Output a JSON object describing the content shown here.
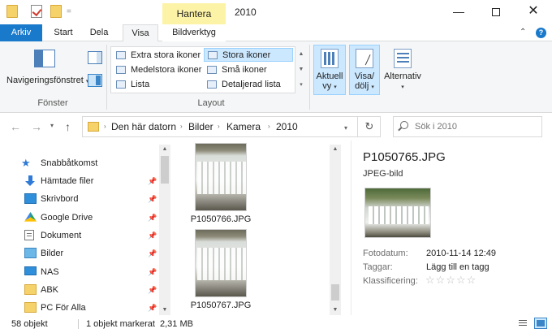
{
  "window": {
    "title": "2010",
    "context_tab": "Hantera",
    "quick_access_sep": "=",
    "minimize": "—",
    "close": "✕"
  },
  "ribbon_tabs": {
    "arkiv": "Arkiv",
    "start": "Start",
    "dela": "Dela",
    "visa": "Visa",
    "bildverktyg": "Bildverktyg",
    "collapse": "⌃",
    "help": "?"
  },
  "ribbon": {
    "navpane_label": "Navigeringsfönstret",
    "navpane_caret": "▾",
    "group_panes": "Fönster",
    "group_layout": "Layout",
    "layout_items": [
      "Extra stora ikoner",
      "Stora ikoner",
      "Medelstora ikoner",
      "Små ikoner",
      "Lista",
      "Detaljerad lista"
    ],
    "layout_scroll": [
      "▲",
      "▼",
      "▾"
    ],
    "aktuell_label": "Aktuell",
    "aktuell_sub": "vy",
    "visadolj_label": "Visa/",
    "visadolj_sub": "dölj",
    "alternativ_label": "Alternativ",
    "caret": "▾"
  },
  "address": {
    "back": "←",
    "forward": "→",
    "recent": "▾",
    "up": "↑",
    "crumbs": [
      "Den här datorn",
      "Bilder",
      "Kamera",
      "2010"
    ],
    "crumb_sep": "›",
    "dropdown": "▾",
    "refresh": "↻",
    "search_placeholder": "Sök i 2010"
  },
  "nav_pane": {
    "items": [
      {
        "label": "Snabbåtkomst",
        "icon": "star-icon"
      },
      {
        "label": "Hämtade filer",
        "icon": "download-icon"
      },
      {
        "label": "Skrivbord",
        "icon": "desktop-icon"
      },
      {
        "label": "Google Drive",
        "icon": "google-drive-icon"
      },
      {
        "label": "Dokument",
        "icon": "document-icon"
      },
      {
        "label": "Bilder",
        "icon": "pictures-icon"
      },
      {
        "label": "NAS",
        "icon": "monitor-icon"
      },
      {
        "label": "ABK",
        "icon": "folder-icon"
      },
      {
        "label": "PC För Alla",
        "icon": "folder-icon"
      }
    ],
    "pin": "📌",
    "star": "★",
    "scroll_up": "▲",
    "scroll_down": "▼"
  },
  "files": {
    "items": [
      {
        "name": "P1050766.JPG"
      },
      {
        "name": "P1050767.JPG"
      }
    ],
    "scroll_up": "▲",
    "scroll_down": "▼"
  },
  "details": {
    "title": "P1050765.JPG",
    "type": "JPEG-bild",
    "props": [
      {
        "label": "Fotodatum:",
        "value": "2010-11-14 12:49"
      },
      {
        "label": "Taggar:",
        "value": "Lägg till en tagg"
      },
      {
        "label": "Klassificering:",
        "value": ""
      }
    ],
    "stars": "☆☆☆☆☆",
    "rating": 0
  },
  "status": {
    "count": "58 objekt",
    "selected": "1 objekt markerat",
    "size": "2,31 MB"
  }
}
